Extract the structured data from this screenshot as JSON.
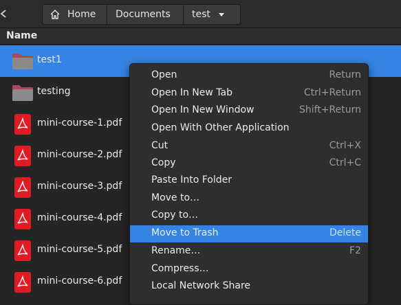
{
  "breadcrumb": {
    "home": "Home",
    "documents": "Documents",
    "current": "test"
  },
  "column_header": "Name",
  "files": [
    {
      "name": "test1",
      "type": "folder",
      "selected": true
    },
    {
      "name": "testing",
      "type": "folder",
      "selected": false
    },
    {
      "name": "mini-course-1.pdf",
      "type": "pdf",
      "selected": false
    },
    {
      "name": "mini-course-2.pdf",
      "type": "pdf",
      "selected": false
    },
    {
      "name": "mini-course-3.pdf",
      "type": "pdf",
      "selected": false
    },
    {
      "name": "mini-course-4.pdf",
      "type": "pdf",
      "selected": false
    },
    {
      "name": "mini-course-5.pdf",
      "type": "pdf",
      "selected": false
    },
    {
      "name": "mini-course-6.pdf",
      "type": "pdf",
      "selected": false
    }
  ],
  "context_menu": [
    {
      "label": "Open",
      "shortcut": "Return"
    },
    {
      "label": "Open In New Tab",
      "shortcut": "Ctrl+Return"
    },
    {
      "label": "Open In New Window",
      "shortcut": "Shift+Return"
    },
    {
      "label": "Open With Other Application",
      "shortcut": ""
    },
    {
      "label": "Cut",
      "shortcut": "Ctrl+X"
    },
    {
      "label": "Copy",
      "shortcut": "Ctrl+C"
    },
    {
      "label": "Paste Into Folder",
      "shortcut": ""
    },
    {
      "label": "Move to…",
      "shortcut": ""
    },
    {
      "label": "Copy to…",
      "shortcut": ""
    },
    {
      "label": "Move to Trash",
      "shortcut": "Delete",
      "highlighted": true
    },
    {
      "label": "Rename…",
      "shortcut": "F2"
    },
    {
      "label": "Compress…",
      "shortcut": ""
    },
    {
      "label": "Local Network Share",
      "shortcut": ""
    }
  ],
  "colors": {
    "accent": "#3584e4",
    "pdf_red": "#e01b24",
    "folder": "#8a8a8a"
  }
}
